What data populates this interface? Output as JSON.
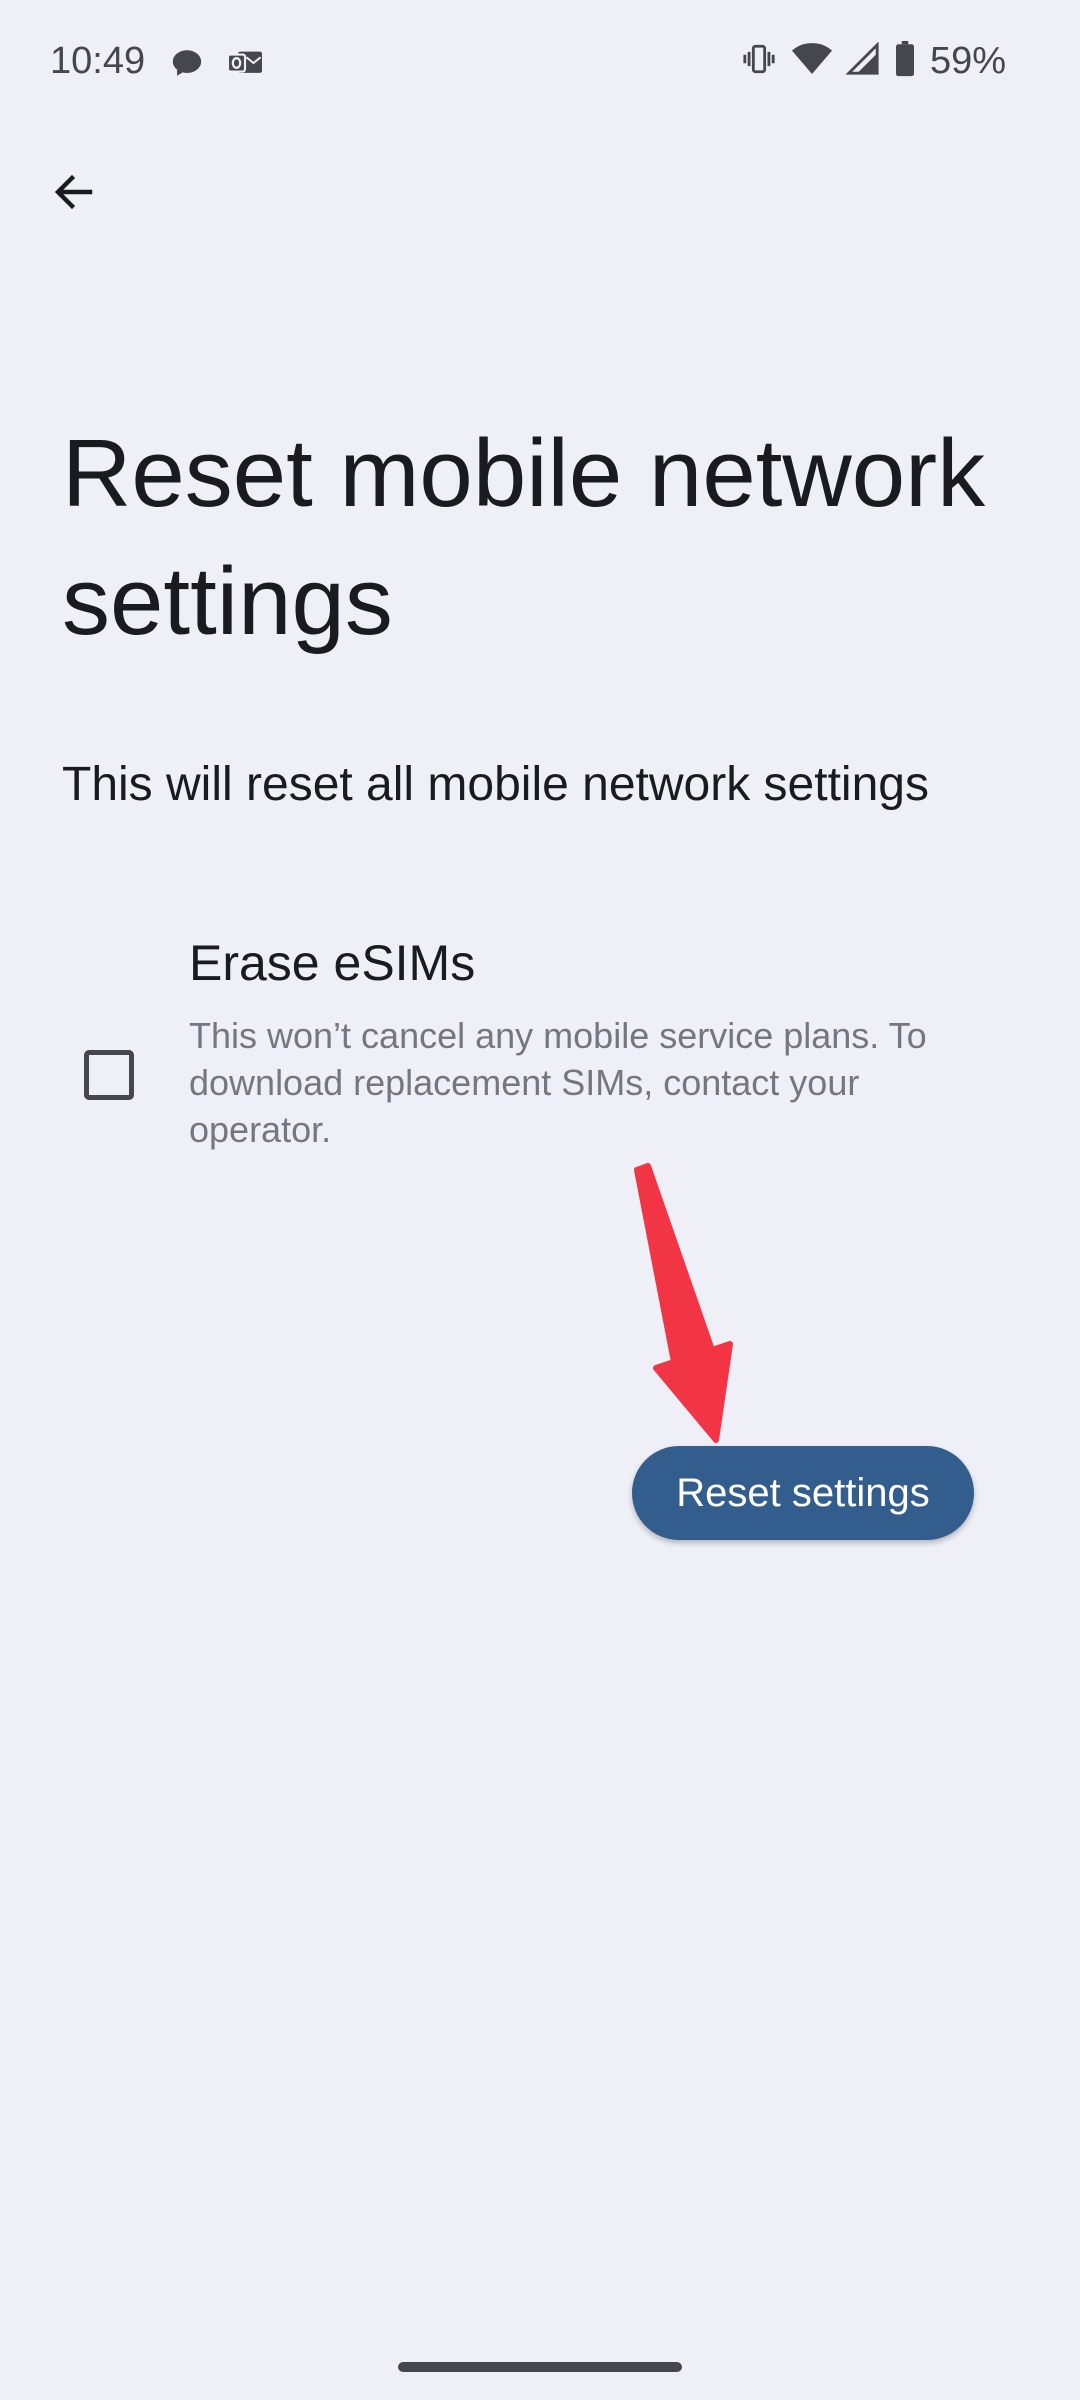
{
  "status_bar": {
    "time": "10:49",
    "battery_percent": "59%",
    "left_icons": [
      "chat-bubble-icon",
      "outlook-mail-icon"
    ],
    "right_icons": [
      "vibrate-icon",
      "wifi-icon",
      "cellular-signal-icon",
      "battery-icon"
    ]
  },
  "toolbar": {
    "back_icon": "arrow-left-icon"
  },
  "page": {
    "title": "Reset mobile network settings",
    "description": "This will reset all mobile network settings"
  },
  "erase_esims": {
    "title": "Erase eSIMs",
    "summary": "This won’t cancel any mobile service plans. To download replacement SIMs, contact your operator.",
    "checked": false
  },
  "actions": {
    "reset_label": "Reset settings"
  },
  "colors": {
    "background": "#eff0f7",
    "primary_button": "#325d8c",
    "annotation_arrow": "#f23545"
  }
}
